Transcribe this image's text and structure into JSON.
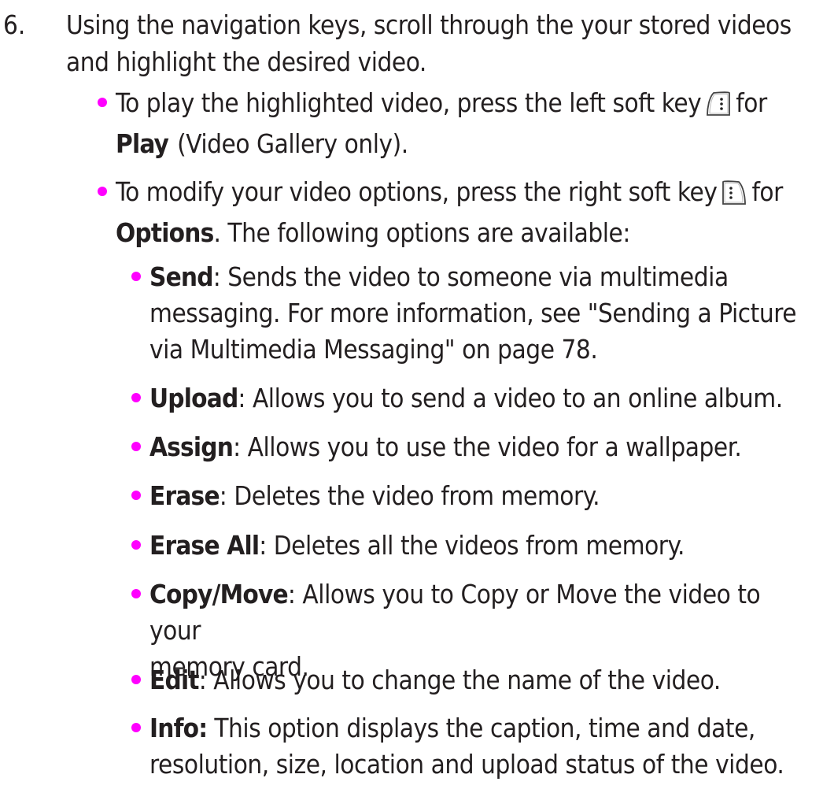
{
  "step": {
    "number": "6.",
    "line1": "Using the navigation keys, scroll through the your stored videos",
    "line2": "and highlight the desired video."
  },
  "bullets": [
    {
      "text_a": "To play the highlighted video, press the left soft key",
      "text_b": "for",
      "bold": "Play",
      "rest": "(Video Gallery only).",
      "icon": "left-softkey-icon"
    },
    {
      "text_a": "To modify your video options, press the right soft key",
      "text_b": "for",
      "bold": "Options",
      "rest": ". The following options are available:",
      "icon": "right-softkey-icon"
    }
  ],
  "options": [
    {
      "label": "Send",
      "line1": ": Sends the video to someone via multimedia",
      "line2": "messaging. For more information, see \"Sending a Picture",
      "line3": "via Multimedia Messaging\" on page 78."
    },
    {
      "label": "Upload",
      "line1": ": Allows you to send a video to an online album."
    },
    {
      "label": "Assign",
      "line1": ": Allows you to use the video for a wallpaper."
    },
    {
      "label": "Erase",
      "line1": ": Deletes the video from memory."
    },
    {
      "label": "Erase All",
      "line1": ": Deletes all the videos from memory."
    },
    {
      "label": "Copy/Move",
      "line1": ": Allows you to Copy or Move the video to your",
      "line2": "memory card."
    },
    {
      "label": "Edit",
      "line1": ": Allows you to change the name of the video."
    },
    {
      "label": "Info:",
      "line1": " This option displays the caption, time and date,",
      "line2": "resolution, size, location and upload status of the video."
    }
  ],
  "colors": {
    "bullet": "#ff00ff",
    "text": "#231f20"
  }
}
